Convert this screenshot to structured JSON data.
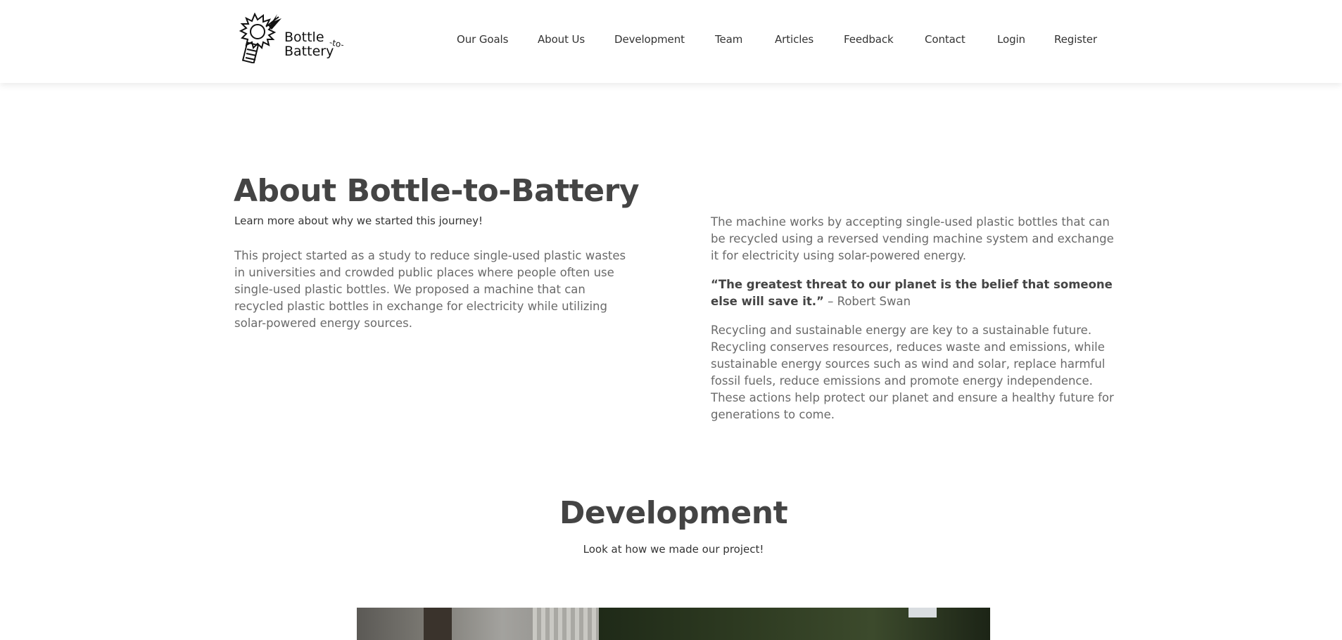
{
  "header": {
    "logo": {
      "word1": "Bottle",
      "word2": "Battery",
      "word3": "-to-"
    },
    "nav": [
      {
        "label": "Our Goals"
      },
      {
        "label": "About Us"
      },
      {
        "label": "Development"
      },
      {
        "label": "Team"
      },
      {
        "label": "Articles"
      },
      {
        "label": "Feedback"
      },
      {
        "label": "Contact"
      },
      {
        "label": "Login"
      },
      {
        "label": "Register"
      }
    ]
  },
  "about": {
    "title": "About Bottle-to-Battery",
    "subtitle": "Learn more about why we started this journey!",
    "left_paragraph": "This project started as a study to reduce single-used plastic wastes in universities and crowded public places where people often use single-used plastic bottles. We proposed a machine that can recycled plastic bottles in exchange for electricity while utilizing solar-powered energy sources.",
    "right_paragraph_1": "The machine works by accepting single-used plastic bottles that can be recycled using a reversed vending machine system and exchange it for electricity using solar-powered energy.",
    "quote": "“The greatest threat to our planet is the belief that someone else will save it.”",
    "quote_author": " – Robert Swan",
    "right_paragraph_2": "Recycling and sustainable energy are key to a sustainable future. Recycling conserves resources, reduces waste and emissions, while sustainable energy sources such as wind and solar, replace harmful fossil fuels, reduce emissions and promote energy independence. These actions help protect our planet and ensure a healthy future for generations to come."
  },
  "development": {
    "title": "Development",
    "subtitle": "Look at how we made our project!"
  },
  "colors": {
    "heading": "#444444",
    "body_text": "#6a6a6a",
    "nav_text": "#333333",
    "background": "#ffffff"
  }
}
